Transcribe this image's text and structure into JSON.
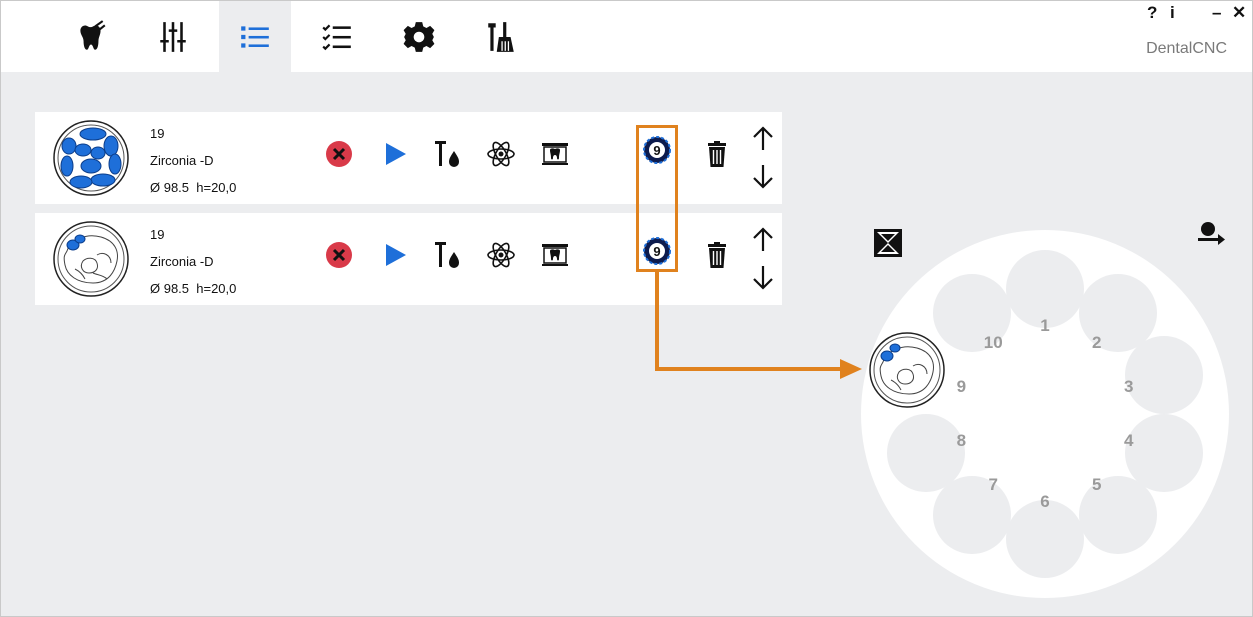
{
  "window": {
    "help": "?",
    "info": "i",
    "minimize": "–",
    "close": "✕",
    "brand": "DentalCNC"
  },
  "toolbar": [
    {
      "name": "tooth-tool-icon",
      "active": false
    },
    {
      "name": "sliders-icon",
      "active": false
    },
    {
      "name": "list-icon",
      "active": true
    },
    {
      "name": "checklist-icon",
      "active": false
    },
    {
      "name": "gear-icon",
      "active": false
    },
    {
      "name": "maintenance-tools-icon",
      "active": false
    }
  ],
  "jobs": [
    {
      "number": "19",
      "material": "Zirconia -D",
      "dims": "Ø 98.5  h=20,0",
      "slot": "9",
      "milled": true
    },
    {
      "number": "19",
      "material": "Zirconia -D",
      "dims": "Ø 98.5  h=20,0",
      "slot": "9",
      "milled": false
    }
  ],
  "changer": {
    "slots": [
      "1",
      "2",
      "3",
      "4",
      "5",
      "6",
      "7",
      "8",
      "9",
      "10"
    ],
    "loaded_slot": "9"
  },
  "colors": {
    "accent_blue": "#1e6fd9",
    "highlight": "#e0821e",
    "cancel_red": "#d93a49"
  }
}
